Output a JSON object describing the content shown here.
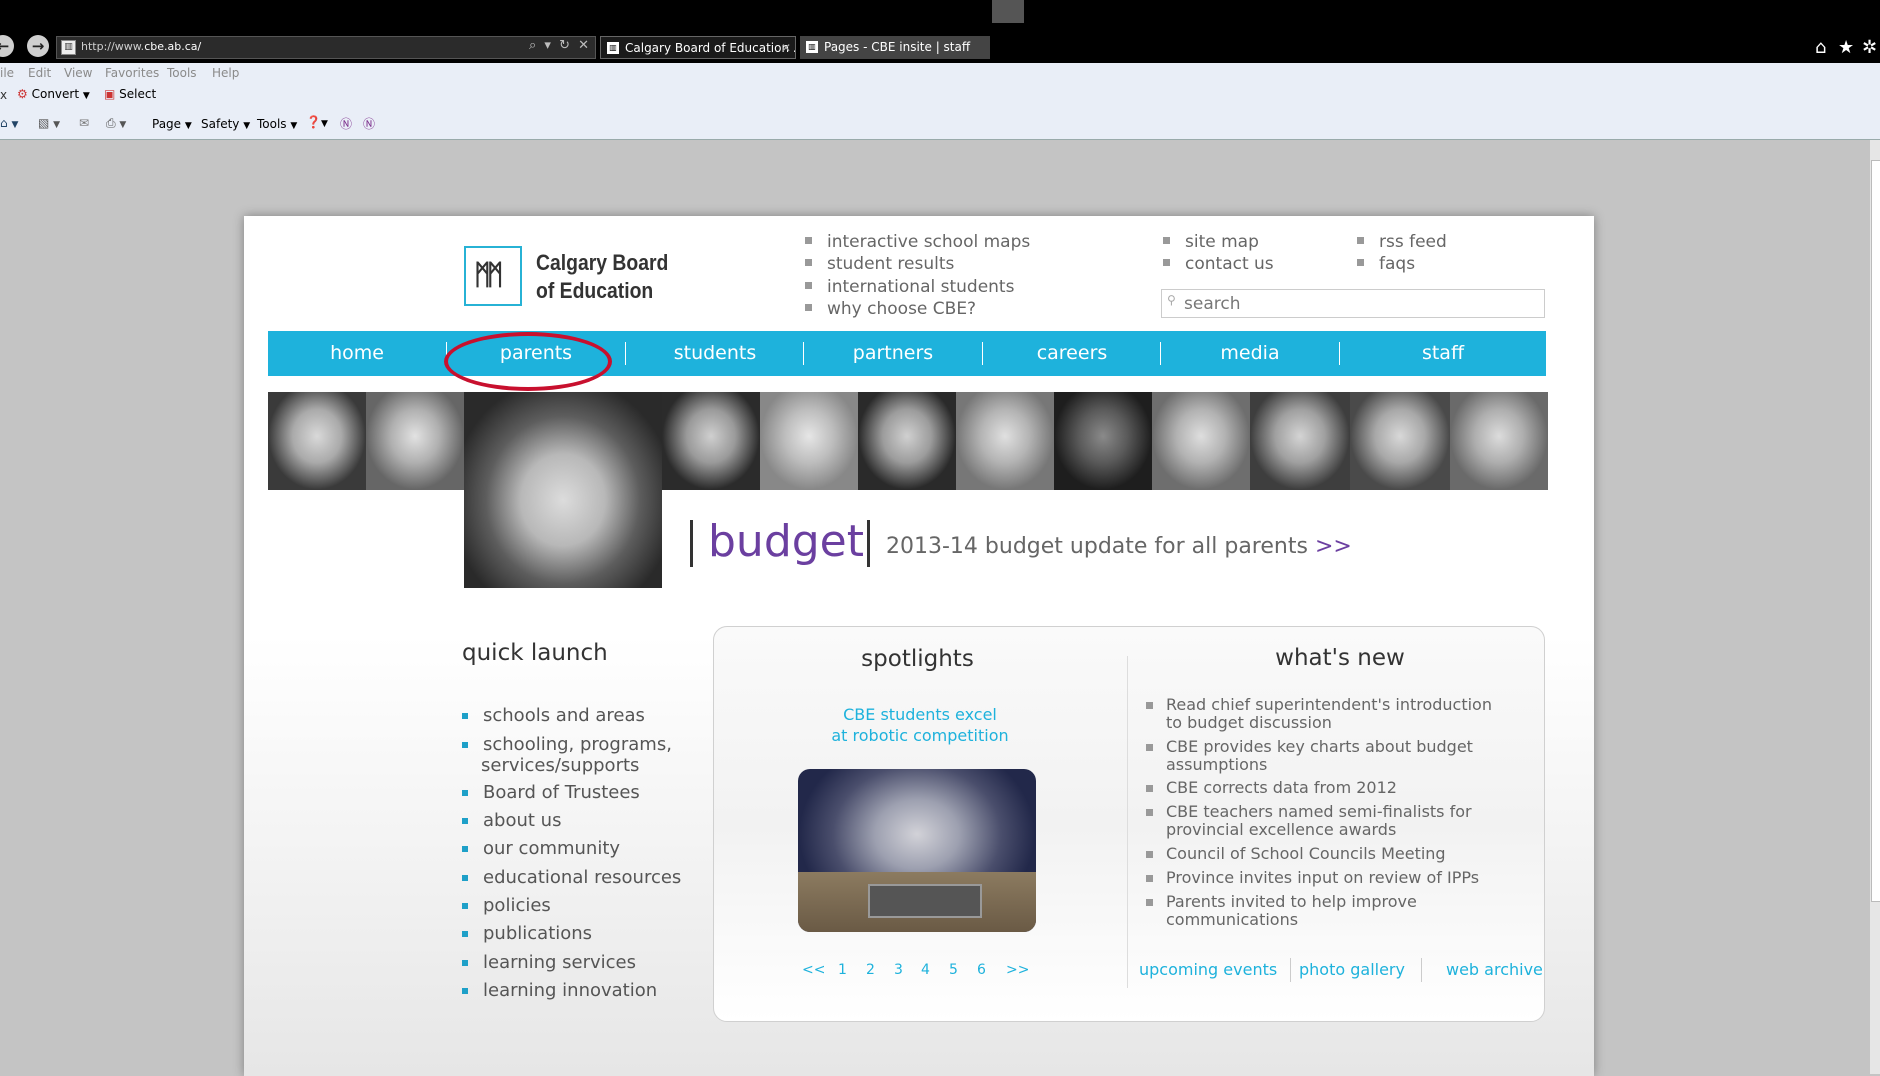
{
  "browser": {
    "url_prefix": "http://www.",
    "url_domain": "cbe.ab.ca/",
    "addr_controls": "⌕ ▾ ↻ ✕",
    "tabs": [
      {
        "label": "Calgary Board of Education ..."
      },
      {
        "label": "Pages - CBE insite | staff"
      }
    ],
    "menu": [
      "ile",
      "Edit",
      "View",
      "Favorites",
      "Tools",
      "Help"
    ],
    "toolbar1": {
      "convert": "Convert",
      "select": "Select"
    },
    "toolbar2": {
      "page": "Page",
      "safety": "Safety",
      "tools": "Tools"
    },
    "icons": {
      "home": "home-icon",
      "favorites": "star-icon",
      "settings": "gear-icon"
    }
  },
  "site": {
    "logo_line1": "Calgary Board",
    "logo_line2": "of Education",
    "top_links_col1": [
      "interactive school maps",
      "student results",
      "international students",
      "why choose CBE?"
    ],
    "top_links_col2": [
      "site map",
      "contact us"
    ],
    "top_links_col3": [
      "rss feed",
      "faqs"
    ],
    "search_placeholder": "search",
    "nav": [
      "home",
      "parents",
      "students",
      "partners",
      "careers",
      "media",
      "staff"
    ],
    "accent": "#1eb2dc",
    "annotation_color": "#c8102e",
    "banner": {
      "word": "budget",
      "sub": "2013-14 budget update for all parents",
      "arrow": ">>"
    },
    "quick_launch": {
      "title": "quick launch",
      "items": [
        "schools and areas",
        "schooling, programs,",
        "services/supports",
        "Board of Trustees",
        "about us",
        "our community",
        "educational resources",
        "policies",
        "publications",
        "learning services",
        "learning innovation"
      ]
    },
    "spotlights": {
      "title": "spotlights",
      "headline_1": "CBE students excel",
      "headline_2": "at robotic competition",
      "pager": [
        "<<",
        "1",
        "2",
        "3",
        "4",
        "5",
        "6",
        ">>"
      ]
    },
    "whats_new": {
      "title": "what's new",
      "items": [
        {
          "l1": "Read chief superintendent's introduction",
          "l2": "to budget discussion"
        },
        {
          "l1": "CBE provides key charts about budget",
          "l2": "assumptions"
        },
        {
          "l1": "CBE corrects data from 2012",
          "l2": ""
        },
        {
          "l1": "CBE teachers named semi-finalists for",
          "l2": "provincial excellence awards"
        },
        {
          "l1": "Council of School Councils Meeting",
          "l2": ""
        },
        {
          "l1": "Province invites input on review of IPPs",
          "l2": ""
        },
        {
          "l1": "Parents invited to help improve",
          "l2": "communications"
        }
      ],
      "links": [
        "upcoming events",
        "photo gallery",
        "web archive"
      ]
    }
  }
}
